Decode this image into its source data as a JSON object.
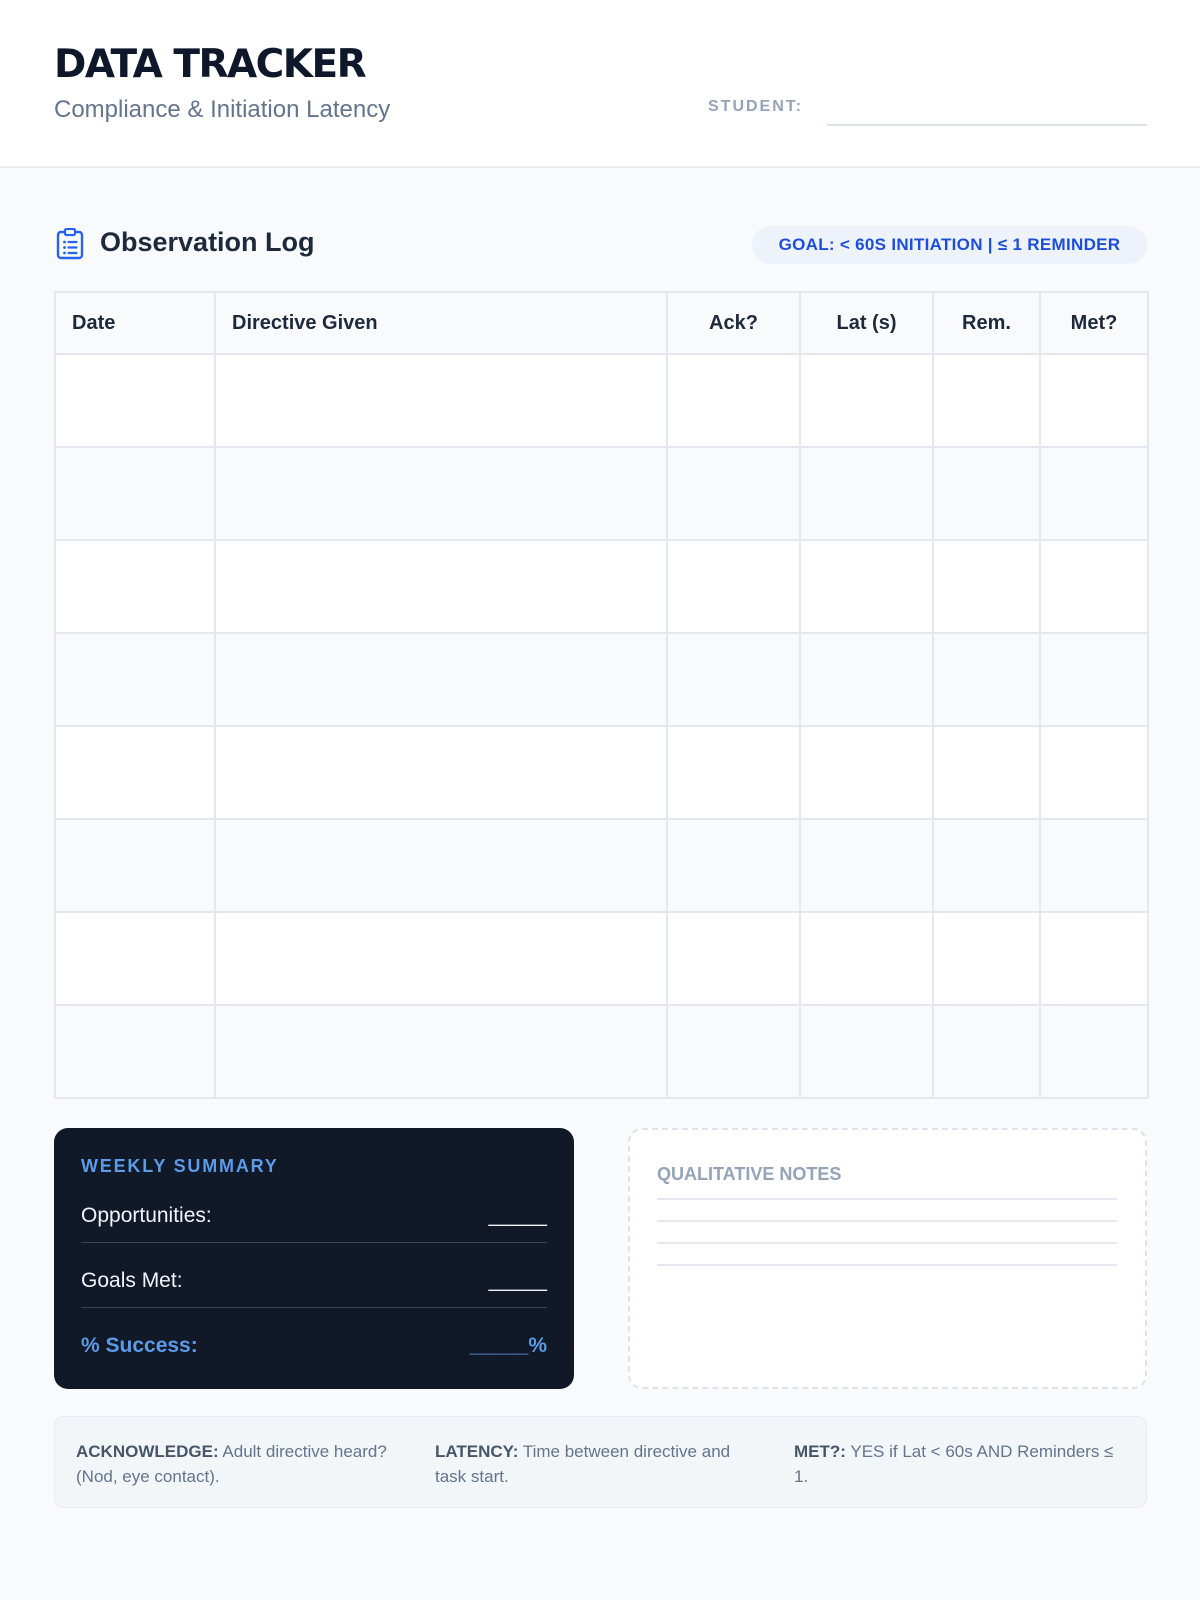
{
  "header": {
    "title": "DATA TRACKER",
    "subtitle": "Compliance & Initiation Latency",
    "student_label": "STUDENT:"
  },
  "section": {
    "icon": "clipboard-list-icon",
    "title": "Observation Log",
    "goal": "GOAL: < 60S INITIATION | ≤ 1 REMINDER"
  },
  "table": {
    "columns": [
      "Date",
      "Directive Given",
      "Ack?",
      "Lat (s)",
      "Rem.",
      "Met?"
    ],
    "rows": [
      [
        "",
        "",
        "",
        "",
        "",
        ""
      ],
      [
        "",
        "",
        "",
        "",
        "",
        ""
      ],
      [
        "",
        "",
        "",
        "",
        "",
        ""
      ],
      [
        "",
        "",
        "",
        "",
        "",
        ""
      ],
      [
        "",
        "",
        "",
        "",
        "",
        ""
      ],
      [
        "",
        "",
        "",
        "",
        "",
        ""
      ],
      [
        "",
        "",
        "",
        "",
        "",
        ""
      ],
      [
        "",
        "",
        "",
        "",
        "",
        ""
      ]
    ]
  },
  "summary": {
    "title": "WEEKLY SUMMARY",
    "opportunities_label": "Opportunities:",
    "opportunities_value": "_____",
    "goals_met_label": "Goals Met:",
    "goals_met_value": "_____",
    "success_label": "% Success:",
    "success_value": "_____%"
  },
  "notes": {
    "title": "QUALITATIVE NOTES"
  },
  "definitions": {
    "ack_term": "ACKNOWLEDGE:",
    "ack_text": "Adult directive heard? (Nod, eye contact).",
    "lat_term": "LATENCY:",
    "lat_text": "Time between directive and task start.",
    "met_term": "MET?:",
    "met_text": "YES if Lat < 60s AND Reminders ≤ 1."
  },
  "colors": {
    "accent": "#1d4ed8",
    "summary_bg": "#111827",
    "summary_accent": "#5b9be8"
  }
}
